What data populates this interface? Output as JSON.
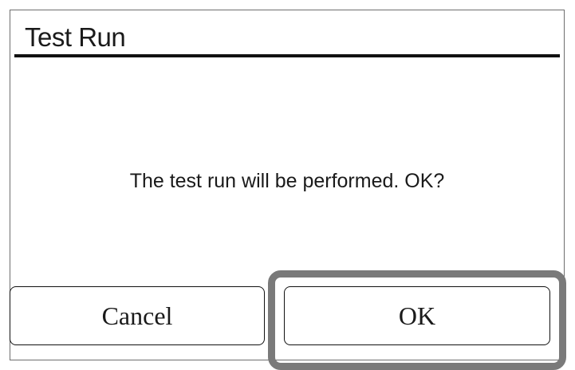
{
  "dialog": {
    "title": "Test Run",
    "message": "The test run will be performed. OK?"
  },
  "buttons": {
    "cancel_label": "Cancel",
    "ok_label": "OK"
  },
  "colors": {
    "highlight_frame": "#7a7a7a",
    "title_rule": "#111111"
  }
}
